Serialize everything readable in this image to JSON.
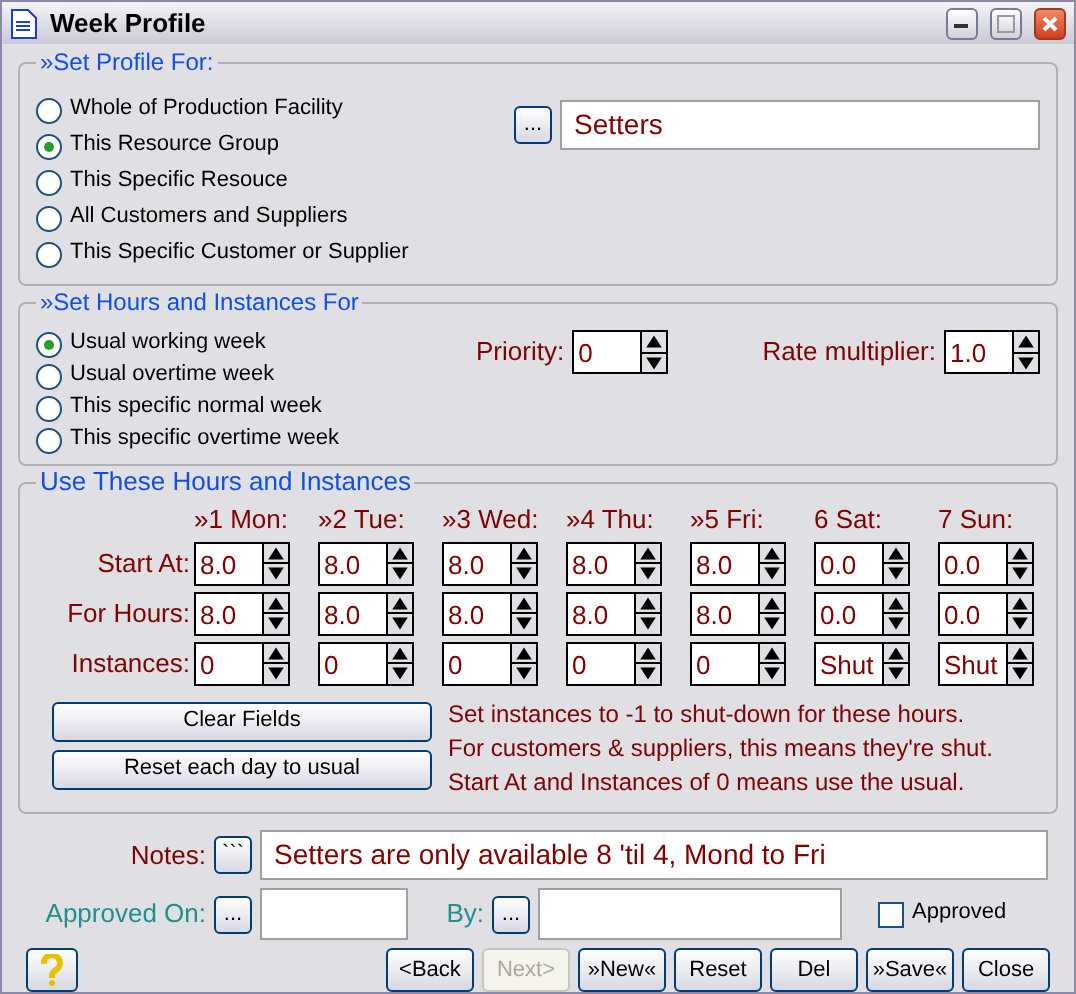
{
  "window": {
    "title": "Week Profile"
  },
  "profile_group": {
    "title": "»Set Profile For:",
    "options": [
      {
        "label": "Whole of Production Facility",
        "selected": false
      },
      {
        "label": "This Resource Group",
        "selected": true
      },
      {
        "label": "This Specific Resouce",
        "selected": false
      },
      {
        "label": "All Customers and Suppliers",
        "selected": false
      },
      {
        "label": "This Specific Customer or Supplier",
        "selected": false
      }
    ],
    "pick_button": "...",
    "value": "Setters"
  },
  "hours_group": {
    "title": "»Set Hours and Instances For",
    "options": [
      {
        "label": "Usual working week",
        "selected": true
      },
      {
        "label": "Usual overtime week",
        "selected": false
      },
      {
        "label": "This specific normal week",
        "selected": false
      },
      {
        "label": "This specific overtime week",
        "selected": false
      }
    ],
    "priority": {
      "label": "Priority:",
      "value": "0"
    },
    "rate": {
      "label": "Rate multiplier:",
      "value": "1.0"
    }
  },
  "instances_group": {
    "title": "Use These Hours and Instances",
    "days": [
      "»1 Mon:",
      "»2 Tue:",
      "»3 Wed:",
      "»4 Thu:",
      "»5 Fri:",
      "6 Sat:",
      "7 Sun:"
    ],
    "rows": [
      {
        "label": "Start At:",
        "values": [
          "8.0",
          "8.0",
          "8.0",
          "8.0",
          "8.0",
          "0.0",
          "0.0"
        ]
      },
      {
        "label": "For Hours:",
        "values": [
          "8.0",
          "8.0",
          "8.0",
          "8.0",
          "8.0",
          "0.0",
          "0.0"
        ]
      },
      {
        "label": "Instances:",
        "values": [
          "0",
          "0",
          "0",
          "0",
          "0",
          "Shut",
          "Shut"
        ]
      }
    ],
    "buttons": [
      "Clear Fields",
      "Reset each day to usual"
    ],
    "messages": [
      "Set instances to -1 to shut-down for these hours.",
      "For customers & suppliers, this means they're shut.",
      "Start At and Instances of 0 means use the usual."
    ]
  },
  "notes": {
    "label": "Notes:",
    "button": "```",
    "value": "Setters are only available 8 'til 4, Mond to Fri"
  },
  "approved_on": {
    "label": "Approved On:",
    "button": "..."
  },
  "by": {
    "label": "By:",
    "button": "..."
  },
  "approved": {
    "label": "Approved",
    "checked": false
  },
  "nav_buttons": [
    {
      "label": "<Back",
      "disabled": false
    },
    {
      "label": "Next>",
      "disabled": true
    },
    {
      "label": "»New«",
      "disabled": false
    },
    {
      "label": "Reset",
      "disabled": false
    },
    {
      "label": "Del",
      "disabled": false
    },
    {
      "label": "»Save«",
      "disabled": false
    },
    {
      "label": "Close",
      "disabled": false
    }
  ]
}
